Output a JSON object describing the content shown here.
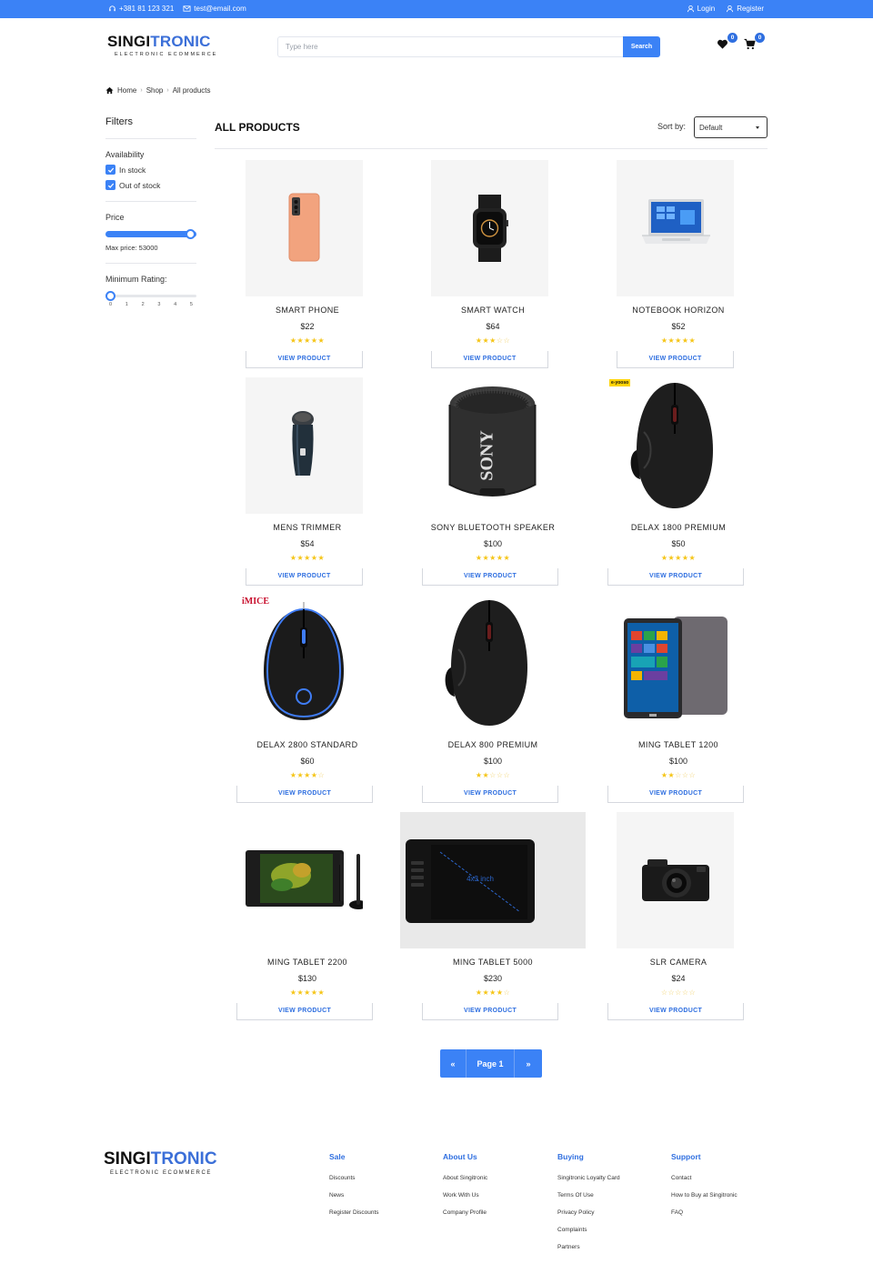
{
  "topbar": {
    "phone": "+381 81 123 321",
    "email": "test@email.com",
    "login": "Login",
    "register": "Register"
  },
  "header": {
    "logo_a": "SINGI",
    "logo_b": "TRONIC",
    "logo_tag": "ELECTRONIC ECOMMERCE",
    "search_placeholder": "Type here",
    "search_button": "Search",
    "wishlist_count": "0",
    "cart_count": "0"
  },
  "breadcrumb": {
    "home": "Home",
    "shop": "Shop",
    "current": "All products"
  },
  "filters": {
    "title": "Filters",
    "availability": "Availability",
    "in_stock": "In stock",
    "out_of_stock": "Out of stock",
    "price": "Price",
    "price_level": 1.0,
    "max_price": "Max price: 53000",
    "min_rating": "Minimum Rating:",
    "rating_value": 0,
    "rating_ticks": [
      "0",
      "1",
      "2",
      "3",
      "4",
      "5"
    ]
  },
  "main": {
    "title": "ALL PRODUCTS",
    "sort_label": "Sort by:",
    "sort_value": "Default",
    "view_label": "VIEW PRODUCT"
  },
  "products": [
    {
      "name": "SMART PHONE",
      "price": "$22",
      "rating": 5,
      "icon": "phone-image"
    },
    {
      "name": "SMART WATCH",
      "price": "$64",
      "rating": 3,
      "icon": "watch-image"
    },
    {
      "name": "NOTEBOOK HORIZON",
      "price": "$52",
      "rating": 5,
      "icon": "laptop-image"
    },
    {
      "name": "MENS TRIMMER",
      "price": "$54",
      "rating": 5,
      "icon": "trimmer-image"
    },
    {
      "name": "SONY BLUETOOTH SPEAKER",
      "price": "$100",
      "rating": 5,
      "icon": "speaker-image",
      "brand_text": "SONY"
    },
    {
      "name": "DELAX 1800 PREMIUM",
      "price": "$50",
      "rating": 5,
      "icon": "mouse-image",
      "corner_text": "e-yooso"
    },
    {
      "name": "DELAX 2800 STANDARD",
      "price": "$60",
      "rating": 4,
      "icon": "gaming-mouse-image",
      "corner_text": "iMICE"
    },
    {
      "name": "DELAX 800 PREMIUM",
      "price": "$100",
      "rating": 2,
      "icon": "mouse-image"
    },
    {
      "name": "MING TABLET 1200",
      "price": "$100",
      "rating": 2,
      "icon": "tablet-image"
    },
    {
      "name": "MING TABLET 2200",
      "price": "$130",
      "rating": 5,
      "icon": "pen-display-image"
    },
    {
      "name": "MING TABLET 5000",
      "price": "$230",
      "rating": 4,
      "icon": "drawing-tablet-image",
      "screen_text": "4x3 inch"
    },
    {
      "name": "SLR CAMERA",
      "price": "$24",
      "rating": 0,
      "icon": "camera-image"
    }
  ],
  "pagination": {
    "prev": "«",
    "page": "Page 1",
    "next": "»"
  },
  "footer": {
    "logo_a": "SINGI",
    "logo_b": "TRONIC",
    "logo_tag": "ELECTRONIC ECOMMERCE",
    "columns": [
      {
        "title": "Sale",
        "links": [
          "Discounts",
          "News",
          "Register Discounts"
        ]
      },
      {
        "title": "About Us",
        "links": [
          "About Singitronic",
          "Work With Us",
          "Company Profile"
        ]
      },
      {
        "title": "Buying",
        "links": [
          "Singitronic Loyalty Card",
          "Terms Of Use",
          "Privacy Policy",
          "Complaints",
          "Partners"
        ]
      },
      {
        "title": "Support",
        "links": [
          "Contact",
          "How to Buy at Singitronic",
          "FAQ"
        ]
      }
    ]
  },
  "colors": {
    "accent": "#3b82f6",
    "link": "#2f6fe0",
    "star": "#f5c518"
  }
}
